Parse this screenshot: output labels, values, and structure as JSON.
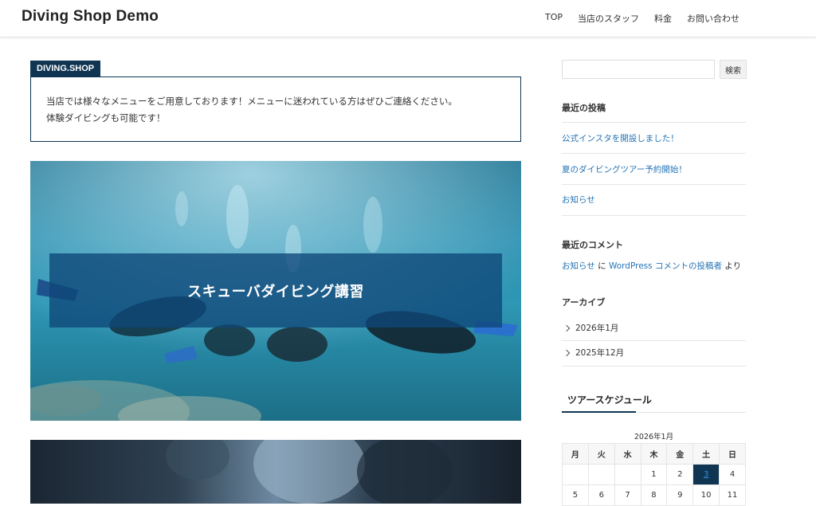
{
  "header": {
    "site_title": "Diving Shop Demo",
    "nav": [
      "TOP",
      "当店のスタッフ",
      "料金",
      "お問い合わせ"
    ]
  },
  "info": {
    "tag": "DIVING.SHOP",
    "line1": "当店では様々なメニューをご用意しております！メニューに迷われている方はぜひご連絡ください。",
    "line2": "体験ダイビングも可能です！"
  },
  "hero": {
    "title": "スキューバダイビング講習"
  },
  "sidebar": {
    "search_placeholder": "",
    "search_button": "検索",
    "recent_posts_title": "最近の投稿",
    "recent_posts": [
      "公式インスタを開設しました！",
      "夏のダイビングツアー予約開始！",
      "お知らせ"
    ],
    "recent_comments_title": "最近のコメント",
    "comment": {
      "post": "お知らせ",
      "joiner": "に",
      "author": "WordPress コメントの投稿者",
      "suffix": "より"
    },
    "archive_title": "アーカイブ",
    "archives": [
      "2026年1月",
      "2025年12月"
    ],
    "tour_title": "ツアースケジュール",
    "calendar": {
      "caption": "2026年1月",
      "weekdays": [
        "月",
        "火",
        "水",
        "木",
        "金",
        "土",
        "日"
      ],
      "row1": [
        "",
        "",
        "",
        "1",
        "2",
        "3",
        "4"
      ],
      "row2": [
        "5",
        "6",
        "7",
        "8",
        "9",
        "10",
        "11"
      ],
      "today": "3"
    }
  },
  "colors": {
    "accent": "#0f3552",
    "link": "#2574b5"
  }
}
